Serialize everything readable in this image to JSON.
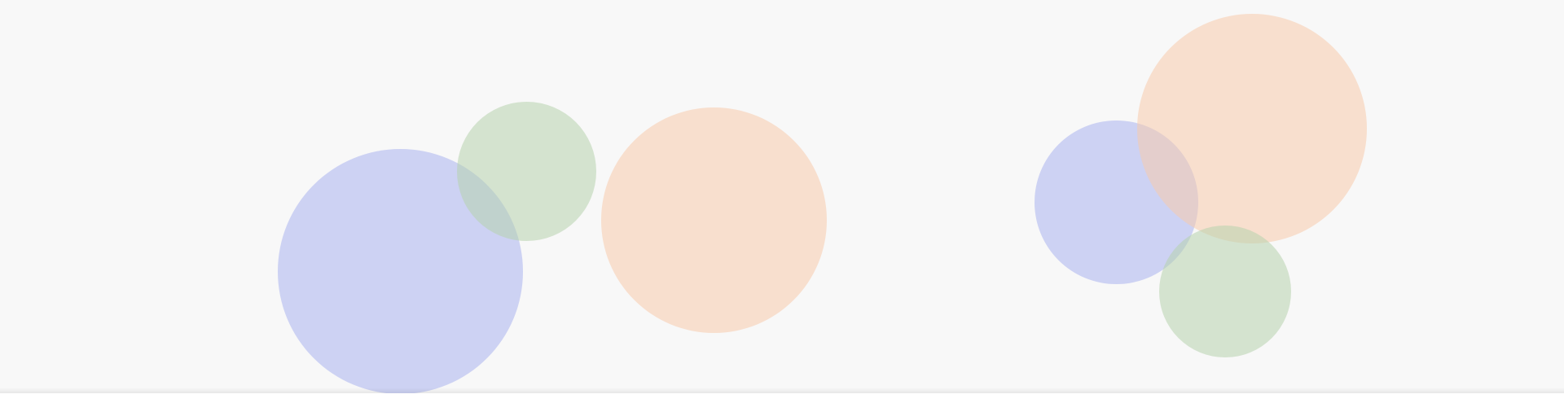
{
  "background": {
    "color": "#f8f8f8"
  },
  "palette": {
    "blue": "#aab2ee",
    "green": "#b6d1ad",
    "orange": "#f7cbac"
  },
  "bubbles": [
    {
      "name": "bubble-blue-large",
      "color": "blue"
    },
    {
      "name": "bubble-green-small",
      "color": "green"
    },
    {
      "name": "bubble-orange-center",
      "color": "orange"
    },
    {
      "name": "bubble-blue-right",
      "color": "blue"
    },
    {
      "name": "bubble-orange-top-right",
      "color": "orange"
    },
    {
      "name": "bubble-green-bottom-right",
      "color": "green"
    }
  ]
}
